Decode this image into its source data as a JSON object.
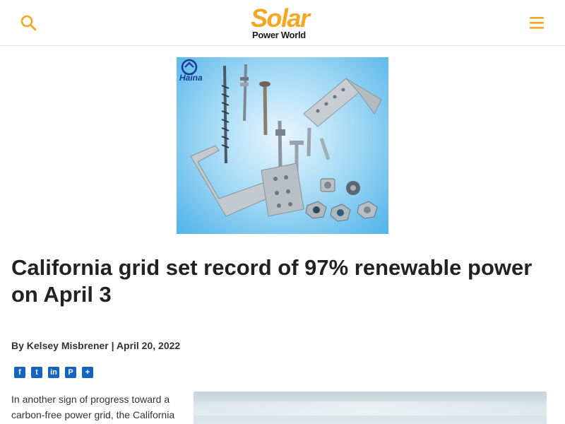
{
  "header": {
    "logo_top": "Solar",
    "logo_bottom": "Power World",
    "search_icon": "search-icon",
    "menu_icon": "hamburger-menu-icon",
    "accent_color": "#f5a623"
  },
  "ad": {
    "brand": "Haina",
    "background_color": "#4fb3ea"
  },
  "article": {
    "title": "California grid set record of 97% renewable power on April 3",
    "byline": "By Kelsey Misbrener | April 20, 2022",
    "share": [
      {
        "icon": "facebook-icon",
        "glyph": "f"
      },
      {
        "icon": "twitter-icon",
        "glyph": "t"
      },
      {
        "icon": "linkedin-icon",
        "glyph": "in"
      },
      {
        "icon": "pinterest-icon",
        "glyph": "P"
      },
      {
        "icon": "share-icon",
        "glyph": "+"
      }
    ],
    "body_lines": [
      "In another sign of progress toward a",
      "carbon-free power grid, the California"
    ]
  }
}
